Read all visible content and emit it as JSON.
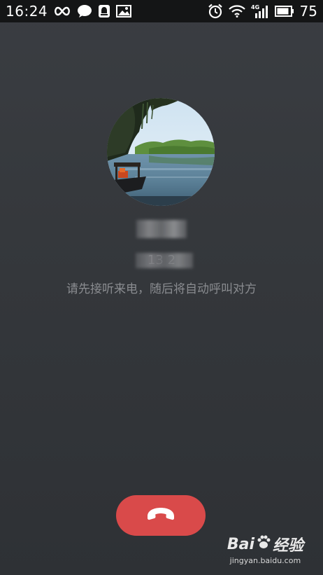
{
  "status_bar": {
    "time": "16:24",
    "battery_level": "75",
    "icons_left": [
      "infinity-icon",
      "chat-bubble-icon",
      "notification-icon",
      "image-icon"
    ],
    "icons_right": [
      "alarm-icon",
      "wifi-icon",
      "signal-4g-icon",
      "battery-icon"
    ],
    "network_label": "4G"
  },
  "caller": {
    "name": "",
    "number": "13         2",
    "avatar_icon": "lake-landscape-avatar"
  },
  "hint": "请先接听来电，随后将自动呼叫对方",
  "end_call": {
    "icon": "end-call-icon",
    "color": "#d94a4a"
  },
  "watermark": {
    "logo_text_a": "Bai",
    "logo_text_b": "du",
    "logo_text_c": "经验",
    "url": "jingyan.baidu.com"
  }
}
